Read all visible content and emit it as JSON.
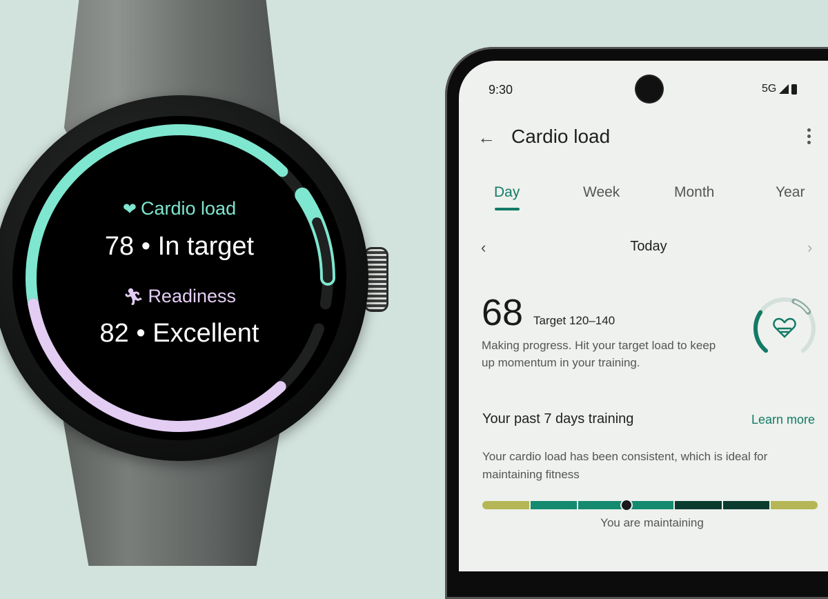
{
  "watch": {
    "cardio_load": {
      "icon": "heart-icon",
      "title": "Cardio load",
      "value": "78",
      "status": "In target",
      "separator": "•",
      "progress_fraction": 0.72,
      "target_start_fraction": 0.78,
      "target_end_fraction": 0.95
    },
    "readiness": {
      "icon": "running-person-icon",
      "title": "Readiness",
      "value": "82",
      "status": "Excellent",
      "separator": "•",
      "progress_fraction": 0.82
    },
    "colors": {
      "cardio": "#7fe6cf",
      "readiness": "#e3cdf3",
      "track": "#1f2120"
    }
  },
  "phone": {
    "status_bar": {
      "time": "9:30",
      "network": "5G"
    },
    "app_bar": {
      "title": "Cardio load",
      "back_icon": "arrow-left-icon",
      "menu_icon": "more-vert-icon"
    },
    "tabs": [
      {
        "label": "Day",
        "active": true
      },
      {
        "label": "Week",
        "active": false
      },
      {
        "label": "Month",
        "active": false
      },
      {
        "label": "Year",
        "active": false
      }
    ],
    "date_nav": {
      "label": "Today",
      "prev_icon": "chevron-left-icon",
      "next_icon": "chevron-right-icon"
    },
    "summary": {
      "value": "68",
      "target": "Target 120–140",
      "description": "Making progress. Hit your target load to keep up momentum in your training.",
      "ring_progress_fraction": 0.3,
      "ring_icon": "heart-icon"
    },
    "training": {
      "title": "Your past 7 days training",
      "learn_more": "Learn more",
      "description": "Your cardio load has been consistent, which is ideal for maintaining fitness",
      "status": "You are maintaining",
      "scale_segments": [
        {
          "color": "#b5b655"
        },
        {
          "color": "#148a6f"
        },
        {
          "color": "#148a6f"
        },
        {
          "color": "#148a6f"
        },
        {
          "color": "#0a3b2e"
        },
        {
          "color": "#0a3b2e"
        },
        {
          "color": "#b5b655"
        }
      ],
      "marker_fraction": 0.43
    },
    "accent_color": "#137a66"
  }
}
